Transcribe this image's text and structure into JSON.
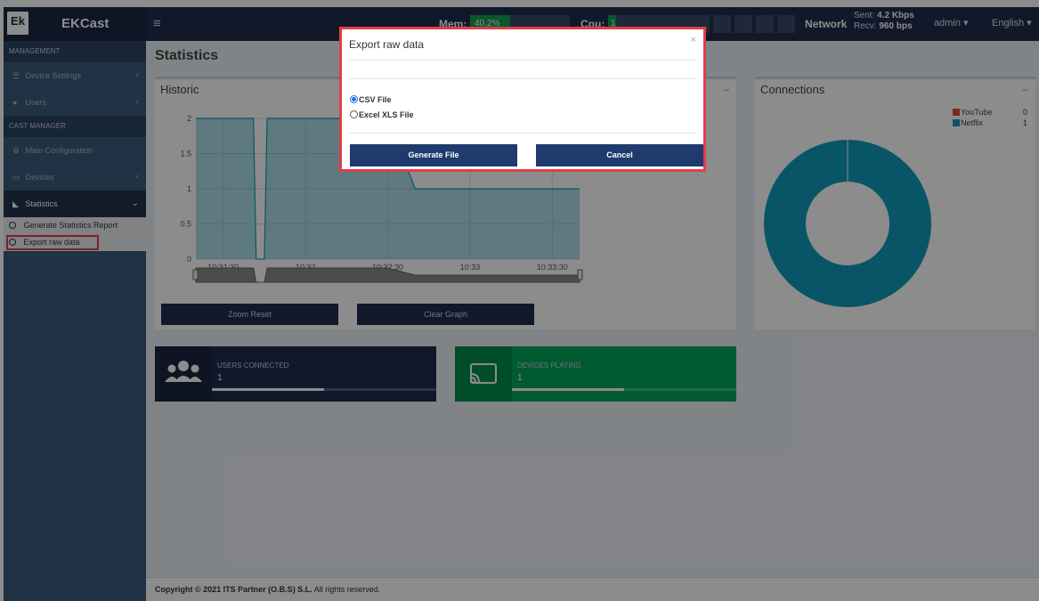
{
  "header": {
    "logo_mark": "Ek",
    "app_name": "EKCast",
    "menu_icon": "hamburger-icon",
    "mem_label": "Mem:",
    "mem_value": "40.2%",
    "mem_fraction": 0.402,
    "cpu_label": "Cpu:",
    "cpu_value": "1",
    "cpu_fraction": 0.08,
    "network_label": "Network",
    "sent_prefix": "Sent:",
    "sent_value": "4.2 Kbps",
    "recv_prefix": "Recv:",
    "recv_value": "960 bps",
    "user": "admin",
    "language": "English"
  },
  "sidebar": {
    "management_header": "MANAGEMENT",
    "device_settings": "Device Settings",
    "users": "Users",
    "cast_manager_header": "CAST MANAGER",
    "main_configuration": "Main Configuration",
    "devices": "Devices",
    "statistics": "Statistics",
    "sub_items": [
      {
        "label": "Generate Statistics Report"
      },
      {
        "label": "Export raw data"
      }
    ]
  },
  "main": {
    "page_title": "Statistics",
    "historic_title": "Historic",
    "connections_title": "Connections",
    "zoom_reset": "Zoom Reset",
    "clear_graph": "Clear Graph",
    "users_connected_label": "USERS CONNECTED",
    "users_connected_value": "1",
    "users_connected_fraction": 0.5,
    "devices_playing_label": "DEVICES PLAYING",
    "devices_playing_value": "1",
    "devices_playing_fraction": 0.5,
    "footer_prefix": "Copyright © 2021",
    "footer_company": "ITS Partner (O.B.S) S.L.",
    "footer_suffix": "All rights reserved."
  },
  "modal": {
    "title": "Export raw data",
    "close": "×",
    "option_csv": "CSV File",
    "option_xls": "Excel XLS File",
    "generate": "Generate File",
    "cancel": "Cancel"
  },
  "colors": {
    "accent": "#1f2d4d",
    "teal": "#129bbd",
    "youtube": "#dd4b39",
    "green": "#00a65a"
  },
  "chart_data": [
    {
      "type": "area",
      "x": [
        "10:31:20",
        "10:31:30",
        "10:31:41",
        "10:31:42",
        "10:31:45",
        "10:31:46",
        "10:31:50",
        "10:32:00",
        "10:32:30",
        "10:32:40",
        "10:33:00",
        "10:33:30",
        "10:33:40"
      ],
      "x_ticks": [
        "10:31:30",
        "10:32",
        "10:32:30",
        "10:33",
        "10:33:30"
      ],
      "y": [
        2,
        2,
        2,
        0,
        0,
        2,
        2,
        2,
        2,
        1,
        1,
        1,
        1
      ],
      "y_ticks": [
        "0",
        "0.5",
        "1",
        "1.5",
        "2"
      ],
      "ylim": [
        0,
        2
      ]
    },
    {
      "type": "pie",
      "labels": [
        "YouTube",
        "Netflix"
      ],
      "values": [
        0,
        1
      ],
      "colors": [
        "#dd4b39",
        "#129bbd"
      ]
    }
  ]
}
